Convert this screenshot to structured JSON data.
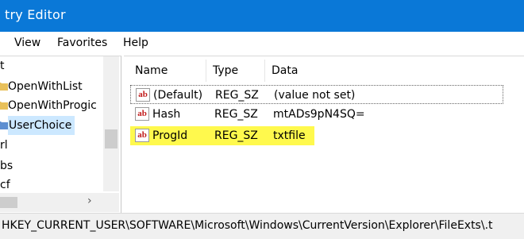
{
  "window": {
    "title": "try Editor"
  },
  "menu": [
    {
      "label": "View"
    },
    {
      "label": "Favorites"
    },
    {
      "label": "Help"
    }
  ],
  "tree": {
    "items": [
      {
        "label": "t"
      },
      {
        "label": "OpenWithList"
      },
      {
        "label": "OpenWithProgic"
      },
      {
        "label": "UserChoice",
        "selected": true
      },
      {
        "label": "rl"
      },
      {
        "label": "bs"
      },
      {
        "label": "cf"
      }
    ]
  },
  "list": {
    "columns": [
      "Name",
      "Type",
      "Data"
    ],
    "rows": [
      {
        "name": "(Default)",
        "type": "REG_SZ",
        "data": "(value not set)"
      },
      {
        "name": "Hash",
        "type": "REG_SZ",
        "data": "mtADs9pN4SQ="
      },
      {
        "name": "ProgId",
        "type": "REG_SZ",
        "data": "txtfile"
      }
    ]
  },
  "statusbar": {
    "path": "HKEY_CURRENT_USER\\SOFTWARE\\Microsoft\\Windows\\CurrentVersion\\Explorer\\FileExts\\.t"
  },
  "colors": {
    "titlebar": "#0a78d7",
    "highlight": "#fff94d",
    "selection": "#cce8ff",
    "folder": "#e8c05a"
  },
  "icons": {
    "folder": "folder-icon",
    "string_value": "reg-string-icon"
  }
}
